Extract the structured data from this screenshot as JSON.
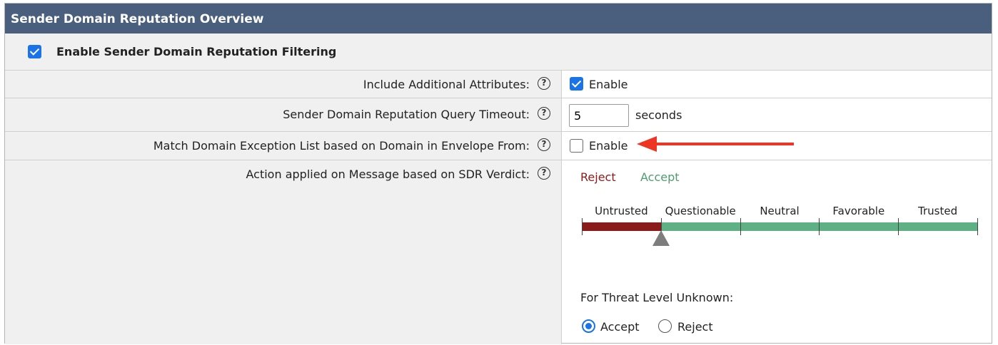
{
  "panel": {
    "title": "Sender Domain Reputation Overview",
    "master": {
      "label": "Enable Sender Domain Reputation Filtering",
      "checked": true
    }
  },
  "rows": {
    "attributes": {
      "label": "Include Additional Attributes:",
      "checkbox_label": "Enable",
      "checked": true
    },
    "timeout": {
      "label": "Sender Domain Reputation Query Timeout:",
      "value": "5",
      "unit": "seconds"
    },
    "exception": {
      "label": "Match Domain Exception List based on Domain in Envelope From:",
      "checkbox_label": "Enable",
      "checked": false
    },
    "action": {
      "label": "Action applied on Message based on SDR Verdict:"
    }
  },
  "help_icon_glyph": "?",
  "verdict": {
    "reject_label": "Reject",
    "accept_label": "Accept",
    "reject_color": "#8b1a1a",
    "accept_color": "#4e9d6c",
    "categories": [
      "Untrusted",
      "Questionable",
      "Neutral",
      "Favorable",
      "Trusted"
    ],
    "threshold_fraction": 0.2
  },
  "unknown": {
    "label": "For Threat Level Unknown:",
    "options": [
      {
        "label": "Accept",
        "selected": true
      },
      {
        "label": "Reject",
        "selected": false
      }
    ]
  },
  "colors": {
    "title_bar": "#4a5f7d",
    "checkbox_checked": "#1a73e8",
    "arrow": "#ee3524",
    "slider_reject": "#8b1a1a",
    "slider_accept": "#5fb085"
  },
  "icons": {
    "help": "question-circle-icon",
    "arrow": "red-arrow-left-icon",
    "thumb": "slider-thumb-triangle-icon"
  }
}
